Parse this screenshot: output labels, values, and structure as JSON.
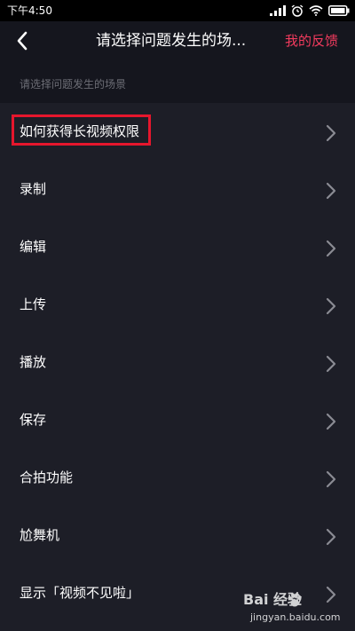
{
  "status_bar": {
    "time": "下午4:50"
  },
  "icons": {
    "status": [
      "signal-icon",
      "alarm-icon",
      "wifi-icon",
      "battery-icon"
    ],
    "back": "chevron-left-icon",
    "row": "chevron-right-icon",
    "watermark": "paw-icon"
  },
  "nav": {
    "title": "请选择问题发生的场...",
    "feedback_label": "我的反馈"
  },
  "section": {
    "label": "请选择问题发生的场景"
  },
  "list": {
    "items": [
      {
        "label": "如何获得长视频权限",
        "highlighted": true
      },
      {
        "label": "录制"
      },
      {
        "label": "编辑"
      },
      {
        "label": "上传"
      },
      {
        "label": "播放"
      },
      {
        "label": "保存"
      },
      {
        "label": "合拍功能"
      },
      {
        "label": "尬舞机"
      },
      {
        "label": "显示「视频不见啦」"
      }
    ]
  },
  "watermark": {
    "brand": "Bai 经验",
    "url": "jingyan.baidu.com"
  },
  "colors": {
    "background": "#15161e",
    "list_background": "#1d1e27",
    "accent": "#f33b5e",
    "highlight_border": "#e6162d",
    "muted_text": "#6c6d75",
    "chevron": "#8a8b93"
  }
}
